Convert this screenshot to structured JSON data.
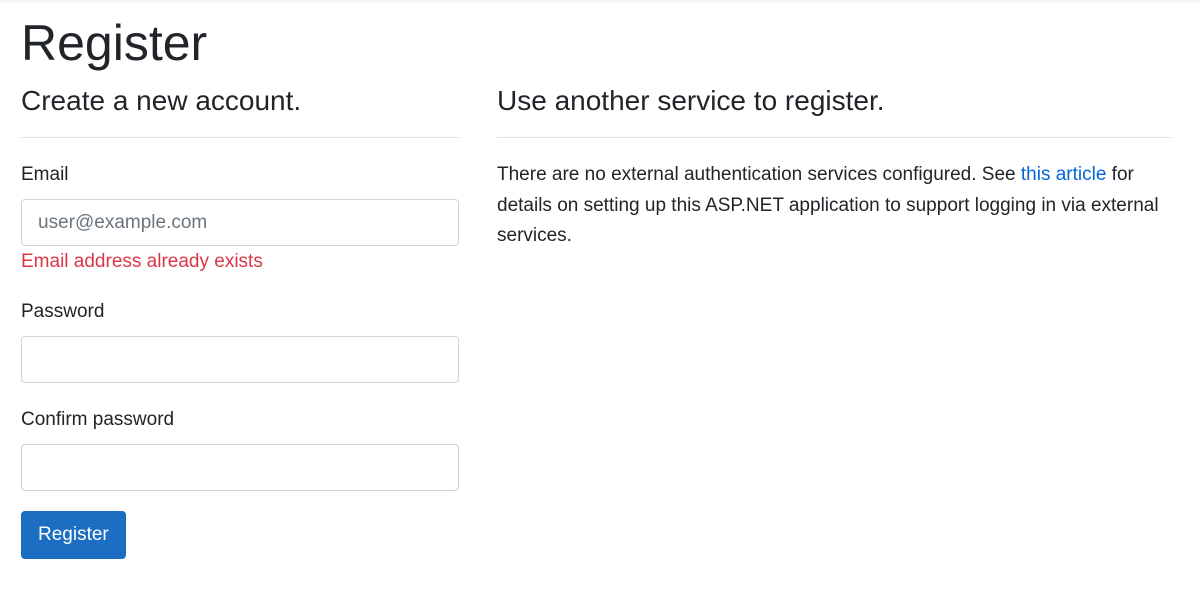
{
  "page": {
    "title": "Register"
  },
  "left": {
    "heading": "Create a new account.",
    "email": {
      "label": "Email",
      "placeholder": "user@example.com",
      "value": "",
      "error": "Email address already exists"
    },
    "password": {
      "label": "Password",
      "value": ""
    },
    "confirm_password": {
      "label": "Confirm password",
      "value": ""
    },
    "submit_label": "Register"
  },
  "right": {
    "heading": "Use another service to register.",
    "info_before": "There are no external authentication services configured. See ",
    "link_text": "this article",
    "info_after": " for details on setting up this ASP.NET application to support logging in via external services."
  },
  "colors": {
    "primary": "#1b6ec2",
    "link": "#0366d6",
    "error": "#dc3545",
    "text": "#212529",
    "border": "#ced4da"
  }
}
